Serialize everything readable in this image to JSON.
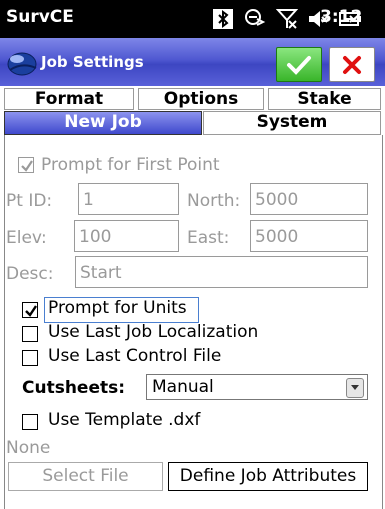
{
  "statusbar": {
    "app_name": "SurvCE",
    "time": "3:12"
  },
  "titlebar": {
    "title": "Job Settings"
  },
  "tabs": {
    "row1": [
      "Format",
      "Options",
      "Stake"
    ],
    "row2": [
      "New Job",
      "System"
    ],
    "active": "New Job"
  },
  "form": {
    "prompt_first_point": {
      "label": "Prompt for First Point",
      "checked": true,
      "enabled": false
    },
    "pt_id": {
      "label": "Pt ID:",
      "value": "1"
    },
    "north": {
      "label": "North:",
      "value": "5000"
    },
    "elev": {
      "label": "Elev:",
      "value": "100"
    },
    "east": {
      "label": "East:",
      "value": "5000"
    },
    "desc": {
      "label": "Desc:",
      "value": "Start"
    },
    "prompt_units": {
      "label": "Prompt for Units",
      "checked": true
    },
    "use_last_localization": {
      "label": "Use Last Job Localization",
      "checked": false
    },
    "use_last_control": {
      "label": "Use Last Control File",
      "checked": false
    },
    "cutsheets": {
      "label": "Cutsheets:",
      "value": "Manual"
    },
    "use_template": {
      "label": "Use Template .dxf",
      "checked": false
    },
    "template_file": "None",
    "select_file_label": "Select File",
    "define_attributes_label": "Define Job Attributes"
  },
  "colors": {
    "accent": "#3f49cd",
    "ok": "#39b52a",
    "cancel": "#e01010"
  }
}
